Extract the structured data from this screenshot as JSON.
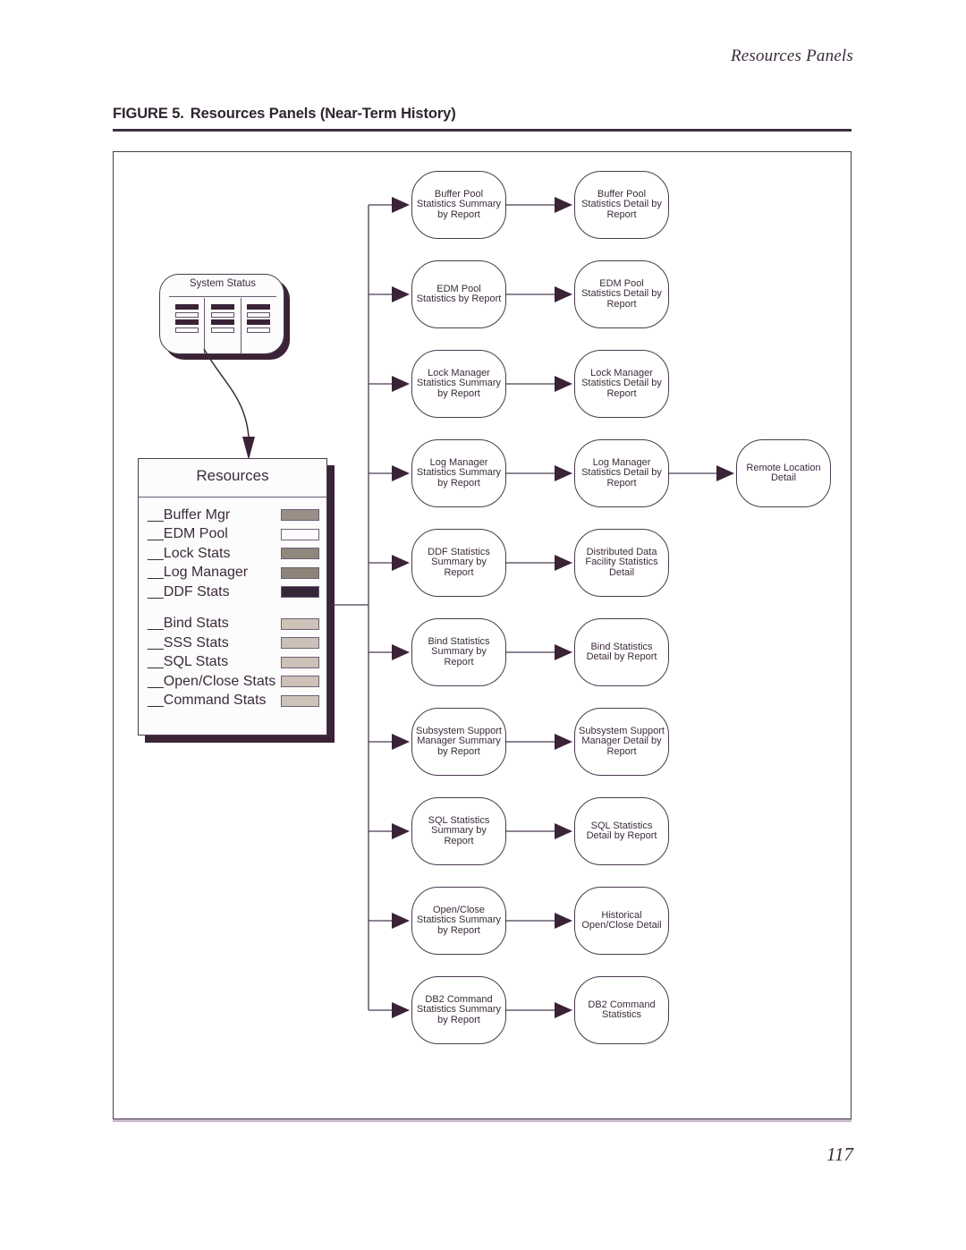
{
  "running_head": "Resources Panels",
  "figure": {
    "label": "FIGURE 5.",
    "title": "Resources Panels (Near-Term History)"
  },
  "page_number": "117",
  "colors": {
    "ink": "#3a2b3a",
    "rule": "#3b3040",
    "frame": "#473a4c",
    "footer_rule": "#c6bacb",
    "shadow": "#3a2336"
  },
  "system_status": {
    "title": "System Status",
    "columns": [
      {
        "bars": [
          "dark",
          "light",
          "dark",
          "light"
        ]
      },
      {
        "bars": [
          "dark",
          "light",
          "dark",
          "light"
        ]
      },
      {
        "bars": [
          "dark",
          "light",
          "dark",
          "light"
        ]
      }
    ]
  },
  "resources_panel": {
    "title": "Resources",
    "items": [
      {
        "label": "__Buffer Mgr",
        "swatch": "#9a8f87",
        "group": 1
      },
      {
        "label": "__EDM Pool",
        "swatch": "#fffafd",
        "group": 1
      },
      {
        "label": "__Lock Stats",
        "swatch": "#8d877c",
        "group": 1
      },
      {
        "label": "__Log Manager",
        "swatch": "#8d8379",
        "group": 1
      },
      {
        "label": "__DDF Stats",
        "swatch": "#362438",
        "group": 1
      },
      {
        "label": "__Bind Stats",
        "swatch": "#cfc2b8",
        "group": 2
      },
      {
        "label": "__SSS Stats",
        "swatch": "#cdc0b8",
        "group": 2
      },
      {
        "label": "__SQL Stats",
        "swatch": "#cdc1b7",
        "group": 2
      },
      {
        "label": "__Open/Close Stats",
        "swatch": "#cdc1b8",
        "group": 2
      },
      {
        "label": "__Command Stats",
        "swatch": "#cfc3b9",
        "group": 2
      }
    ]
  },
  "chart_data": {
    "type": "diagram",
    "title": "Resources Panels (Near-Term History)",
    "layout": "tree: Resources panel branches to 10 summary panels, each chaining right to a detail panel",
    "rows": [
      {
        "id": "buffer-pool",
        "summary": "Buffer Pool Statistics Summary by Report",
        "detail": "Buffer Pool Statistics Detail by Report",
        "third": null
      },
      {
        "id": "edm-pool",
        "summary": "EDM Pool Statistics by Report",
        "detail": "EDM Pool Statistics Detail by Report",
        "third": null
      },
      {
        "id": "lock-manager",
        "summary": "Lock Manager Statistics Summary by Report",
        "detail": "Lock Manager Statistics Detail by Report",
        "third": null
      },
      {
        "id": "log-manager",
        "summary": "Log Manager Statistics Summary by Report",
        "detail": "Log Manager Statistics Detail by Report",
        "third": "Remote Location Detail"
      },
      {
        "id": "ddf",
        "summary": "DDF Statistics Summary by Report",
        "detail": "Distributed Data Facility Statistics Detail",
        "third": null
      },
      {
        "id": "bind",
        "summary": "Bind Statistics Summary by Report",
        "detail": "Bind Statistics Detail by Report",
        "third": null
      },
      {
        "id": "subsystem-support",
        "summary": "Subsystem Support Manager Summary by Report",
        "detail": "Subsystem Support Manager Detail by Report",
        "third": null
      },
      {
        "id": "sql",
        "summary": "SQL Statistics Summary by Report",
        "detail": "SQL Statistics Detail by Report",
        "third": null
      },
      {
        "id": "open-close",
        "summary": "Open/Close Statistics Summary by Report",
        "detail": "Historical Open/Close Detail",
        "third": null
      },
      {
        "id": "db2-command",
        "summary": "DB2 Command Statistics Summary by Report",
        "detail": "DB2 Command Statistics",
        "third": null
      }
    ]
  }
}
